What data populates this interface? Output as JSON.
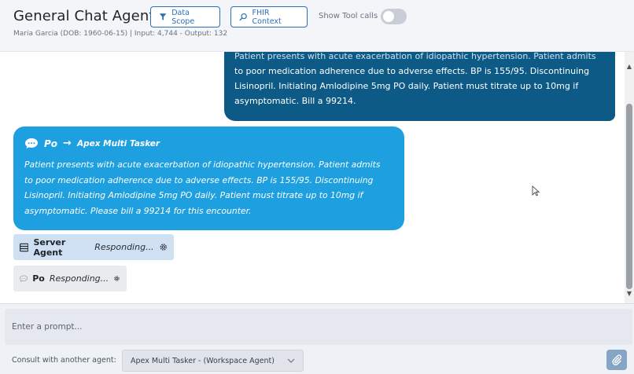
{
  "header": {
    "title": "General Chat Agent",
    "subtitle": "Maria Garcia (DOB: 1960-06-15)  | Input: 4,744 - Output: 132",
    "data_scope_label": "Data Scope",
    "fhir_context_label": "FHIR Context",
    "show_tool_calls_label": "Show Tool calls",
    "show_tool_calls_on": false
  },
  "chat": {
    "user_message_cut_line": "Patient presents with acute exacerbation of idiopathic hypertension. Patient admits",
    "user_message_lines": [
      "to poor medication adherence due to adverse effects. BP is 155/95. Discontinuing",
      "Lisinopril. Initiating Amlodipine 5mg PO daily. Patient must titrate up to 10mg if",
      "asymptomatic. Bill a 99214."
    ],
    "agent_message": {
      "sender": "Po",
      "arrow": "→",
      "recipient": "Apex Multi Tasker",
      "lines": [
        "Patient presents with acute exacerbation of idiopathic hypertension. Patient admits",
        "to poor medication adherence due to adverse effects. BP is 155/95. Discontinuing",
        "Lisinopril. Initiating Amlodipine 5mg PO daily. Patient must titrate up to 10mg if",
        "asymptomatic. Please bill a 99214 for this encounter."
      ]
    },
    "statuses": [
      {
        "name": "Server Agent",
        "state": "Responding..."
      },
      {
        "name": "Po",
        "state": "Responding..."
      }
    ]
  },
  "composer": {
    "placeholder": "Enter a prompt...",
    "consult_label": "Consult with another agent:",
    "consult_selected": "Apex Multi Tasker - (Workspace Agent)"
  },
  "colors": {
    "user_bubble": "#0d5a86",
    "agent_bubble": "#1e9fe0",
    "accent": "#2a6fb8"
  }
}
